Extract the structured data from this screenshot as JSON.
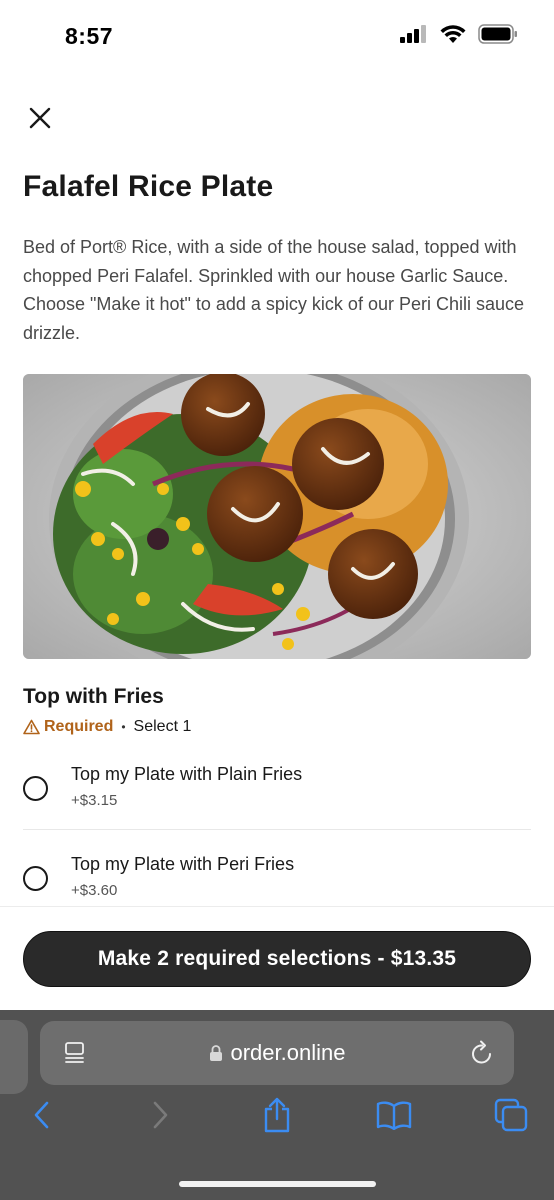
{
  "status_bar": {
    "time": "8:57"
  },
  "item": {
    "title": "Falafel Rice Plate",
    "description": "Bed of Port® Rice, with a side of the house salad, topped with chopped Peri Falafel. Sprinkled with our house Garlic Sauce. Choose \"Make it hot\" to add a spicy kick of our Peri Chili sauce drizzle."
  },
  "options_group": {
    "title": "Top with Fries",
    "required_label": "Required",
    "separator": "•",
    "select_label": "Select 1",
    "options": [
      {
        "name": "Top my Plate with Plain Fries",
        "price": "+$3.15"
      },
      {
        "name": "Top my Plate with Peri Fries",
        "price": "+$3.60"
      }
    ]
  },
  "cta": {
    "label": "Make 2 required selections - $13.35"
  },
  "browser": {
    "url": "order.online"
  },
  "colors": {
    "required": "#b0631a",
    "cta_bg": "#2a2a2a",
    "toolbar_icon": "#3b8cf2"
  }
}
